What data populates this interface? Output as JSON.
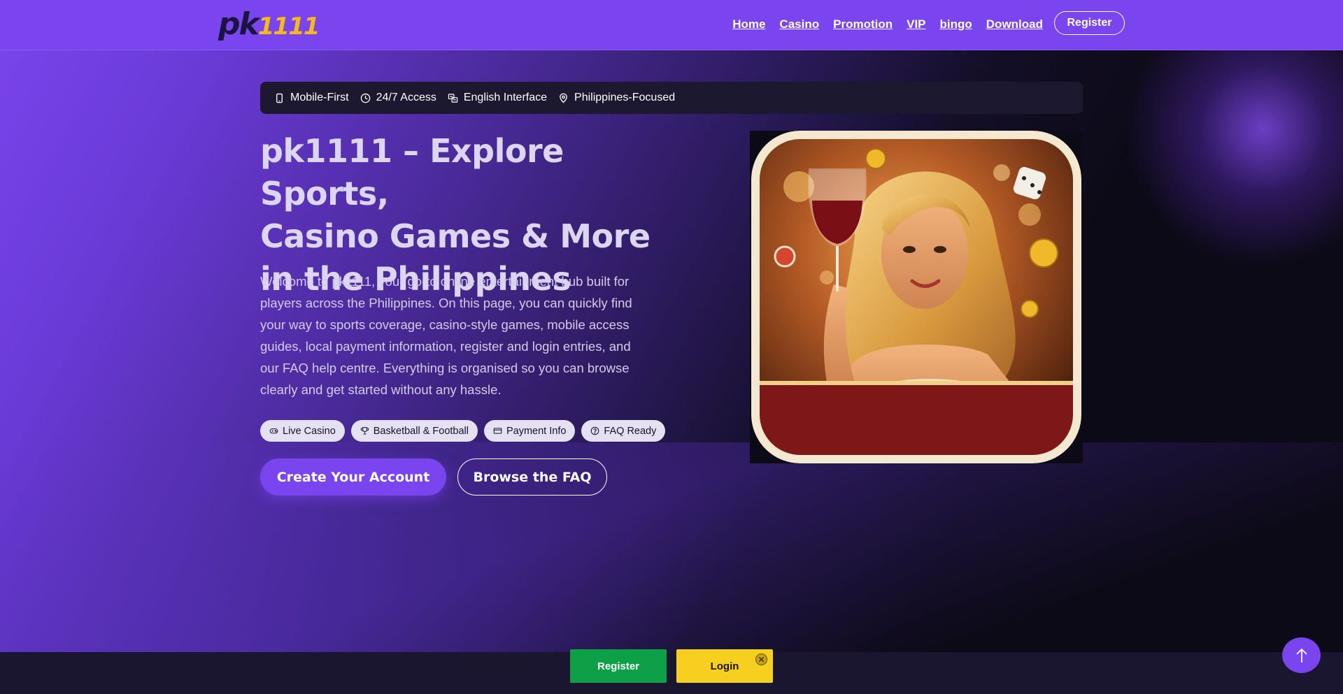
{
  "header": {
    "logo": {
      "pk": "pk",
      "num": "1111"
    },
    "nav": [
      "Home",
      "Casino",
      "Promotion",
      "VIP",
      "bingo",
      "Download"
    ],
    "register_label": "Register"
  },
  "strip": {
    "items": [
      {
        "icon": "smartphone-icon",
        "label": "Mobile-First"
      },
      {
        "icon": "clock-icon",
        "label": "24/7 Access"
      },
      {
        "icon": "language-icon",
        "label": "English Interface"
      },
      {
        "icon": "map-pin-icon",
        "label": "Philippines-Focused"
      }
    ]
  },
  "hero": {
    "title_line1": "pk1111 – Explore Sports,",
    "title_line2": "Casino Games & More",
    "title_line3": "in the Philippines",
    "description": "Welcome to pk1111, your go-to online entertainment hub built for players across the Philippines. On this page, you can quickly find your way to sports coverage, casino-style games, mobile access guides, local payment information, register and login entries, and our FAQ help centre. Everything is organised so you can browse clearly and get started without any hassle.",
    "chips": [
      {
        "icon": "gamepad-icon",
        "label": "Live Casino"
      },
      {
        "icon": "trophy-icon",
        "label": "Basketball & Football"
      },
      {
        "icon": "credit-card-icon",
        "label": "Payment Info"
      },
      {
        "icon": "help-circle-icon",
        "label": "FAQ Ready"
      }
    ],
    "cta_primary": "Create Your Account",
    "cta_secondary": "Browse the FAQ"
  },
  "bottom_bar": {
    "register_label": "Register",
    "login_label": "Login"
  },
  "colors": {
    "accent": "#7a45ee",
    "logo_gold": "#f6b91c",
    "register_green": "#0ea047",
    "login_yellow": "#f7cf1f"
  }
}
